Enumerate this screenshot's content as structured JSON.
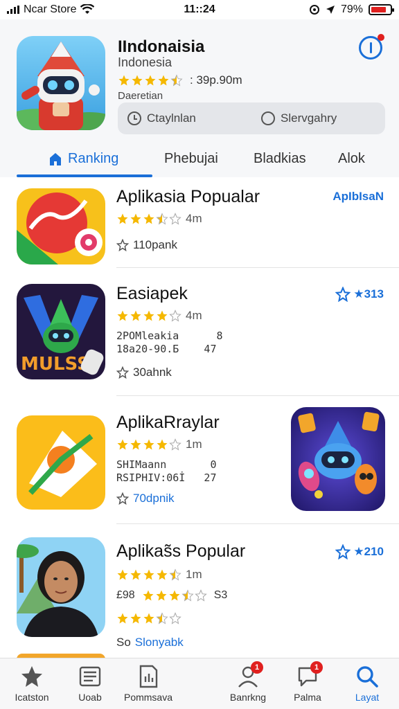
{
  "status": {
    "carrier": "Ncar Store",
    "time": "11::24",
    "battery": "79%",
    "battery_level": 0.79
  },
  "hero": {
    "icon": "robot-mascot-icon",
    "title": "IIndonaisia",
    "subtitle": "Indonesia",
    "rating_text": ": 39p.90m",
    "rating": 4.5,
    "developer": "Daeretian",
    "segment": [
      {
        "label": "Ctaylnlan",
        "icon": "clock-icon"
      },
      {
        "label": "Slervgahry",
        "icon": "circle-icon"
      }
    ]
  },
  "tabs": [
    {
      "label": "Ranking",
      "icon": "home-icon",
      "active": true
    },
    {
      "label": "Phebujai"
    },
    {
      "label": "Bladkias"
    },
    {
      "label": "Alok"
    }
  ],
  "list": [
    {
      "title": "Aplikasia Popualar",
      "rating": 3.5,
      "rating_text": "4m",
      "meta": "",
      "save": "110pank",
      "right": "ApIbIsaN",
      "icon": "chart-app-icon"
    },
    {
      "title": "Easiapek",
      "rating": 4,
      "rating_text": "4m",
      "meta": "2POMleakia      8\n18a20-90.Б    47",
      "save": "30ahnk",
      "right": "★313",
      "icon": "game-app-icon"
    },
    {
      "title": "AplikaRraylar",
      "rating": 4,
      "rating_text": "1m",
      "meta": "SHIMaann       0\nRSIPHIV:06İ   27",
      "save": "70dpnik",
      "right": "",
      "icon": "map-app-icon",
      "side_art": "robot-rocket-art"
    },
    {
      "title": "Aplikas̃s Popular",
      "rating": 4.5,
      "rating_text": "1m",
      "meta": "£98",
      "save": "Slonyabk",
      "save_prefix": "So",
      "right": "★210",
      "icon": "portrait-app-icon",
      "meta_value": "S3"
    }
  ],
  "bottom_nav": [
    {
      "label": "Icatston",
      "icon": "star-icon"
    },
    {
      "label": "Uoab",
      "icon": "document-icon"
    },
    {
      "label": "Pommsava",
      "icon": "file-chart-icon"
    },
    {
      "label": "Banrkng",
      "icon": "person-icon",
      "badge": "1"
    },
    {
      "label": "Palma",
      "icon": "chat-icon",
      "badge": "1"
    },
    {
      "label": "Layat",
      "icon": "search-icon",
      "active": true
    }
  ],
  "colors": {
    "accent": "#1a6fd8",
    "star": "#f5b800",
    "badge": "#e0201f"
  }
}
